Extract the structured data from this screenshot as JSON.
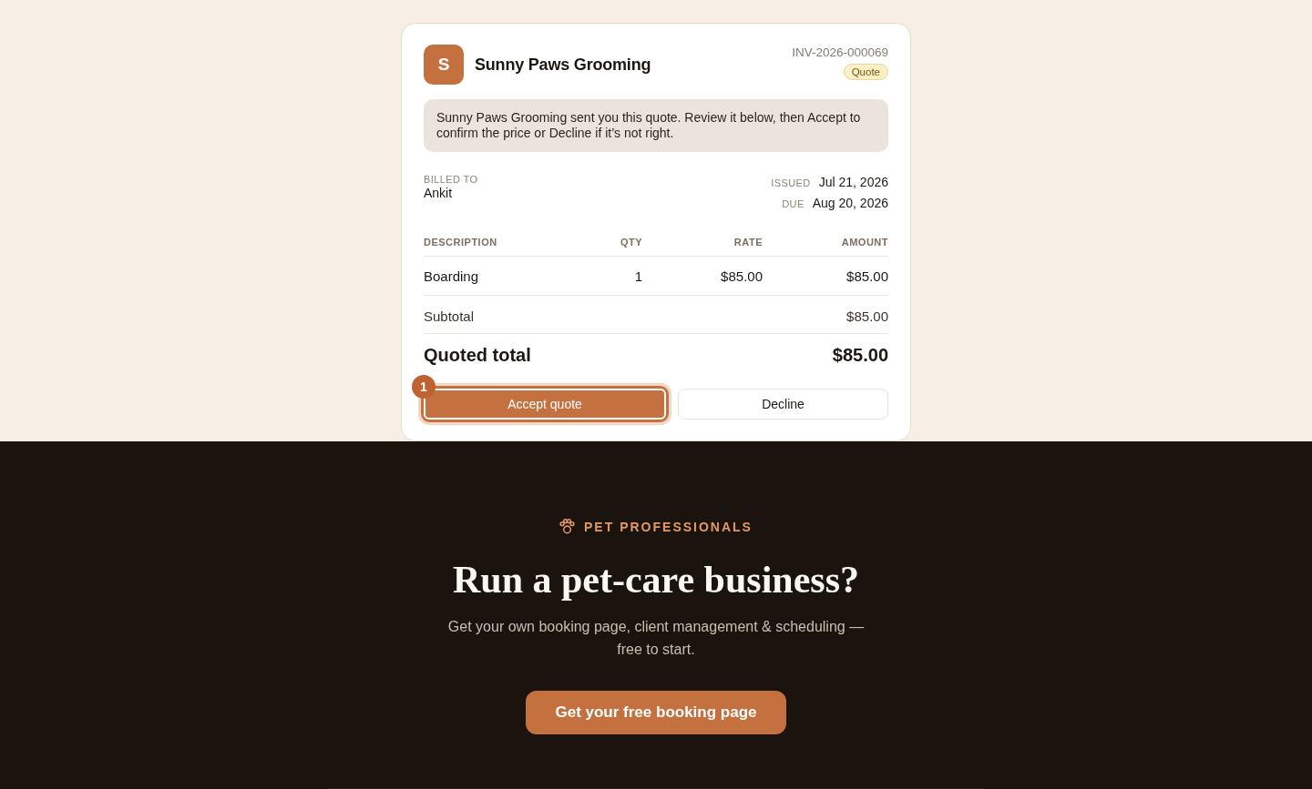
{
  "invoice": {
    "business": {
      "initial": "S",
      "name": "Sunny Paws Grooming"
    },
    "number": "INV-2026-000069",
    "status_badge": "Quote",
    "notice": "Sunny Paws Grooming sent you this quote. Review it below, then Accept to confirm the price or Decline if it’s not right.",
    "billed_to": {
      "label": "BILLED TO",
      "name": "Ankit"
    },
    "dates": [
      {
        "label": "ISSUED",
        "value": "Jul 21, 2026"
      },
      {
        "label": "DUE",
        "value": "Aug 20, 2026"
      }
    ],
    "table": {
      "columns": [
        "DESCRIPTION",
        "QTY",
        "RATE",
        "AMOUNT"
      ],
      "rows": [
        [
          "Boarding",
          "1",
          "$85.00",
          "$85.00"
        ]
      ]
    },
    "subtotal": {
      "label": "Subtotal",
      "value": "$85.00"
    },
    "total": {
      "label": "Quoted total",
      "value": "$85.00"
    },
    "actions": [
      {
        "label": "Accept quote",
        "kind": "primary",
        "focused": true,
        "marker": "1"
      },
      {
        "label": "Decline",
        "kind": "secondary",
        "focused": false
      }
    ]
  },
  "promo": {
    "eyebrow": "PET PROFESSIONALS",
    "heading": "Run a pet-care business?",
    "text": "Get your own booking page, client management & scheduling — free to start.",
    "cta": "Get your free booking page"
  }
}
